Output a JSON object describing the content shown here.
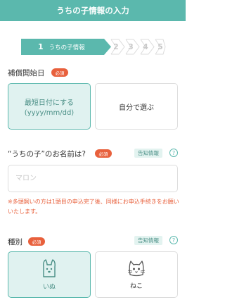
{
  "header": {
    "title": "うちの子情報の入力"
  },
  "steps": {
    "active_number": "1",
    "active_label": "うちの子情報",
    "others": [
      "2",
      "3",
      "4",
      "5"
    ]
  },
  "start_date": {
    "label": "補償開始日",
    "required": "必須",
    "option_earliest_line1": "最短日付にする",
    "option_earliest_line2": "(yyyy/mm/dd)",
    "option_self": "自分で選ぶ"
  },
  "pet_name": {
    "label": "“うちの子”のお名前は?",
    "required": "必須",
    "info_tag": "告知情報",
    "help": "?",
    "placeholder": "マロン",
    "note": "※多頭飼いの方は1頭目の申込完了後、同様にお申込手続きをお願いいたします。"
  },
  "species": {
    "label": "種別",
    "required": "必須",
    "info_tag": "告知情報",
    "help": "?",
    "dog": "いぬ",
    "cat": "ねこ"
  }
}
